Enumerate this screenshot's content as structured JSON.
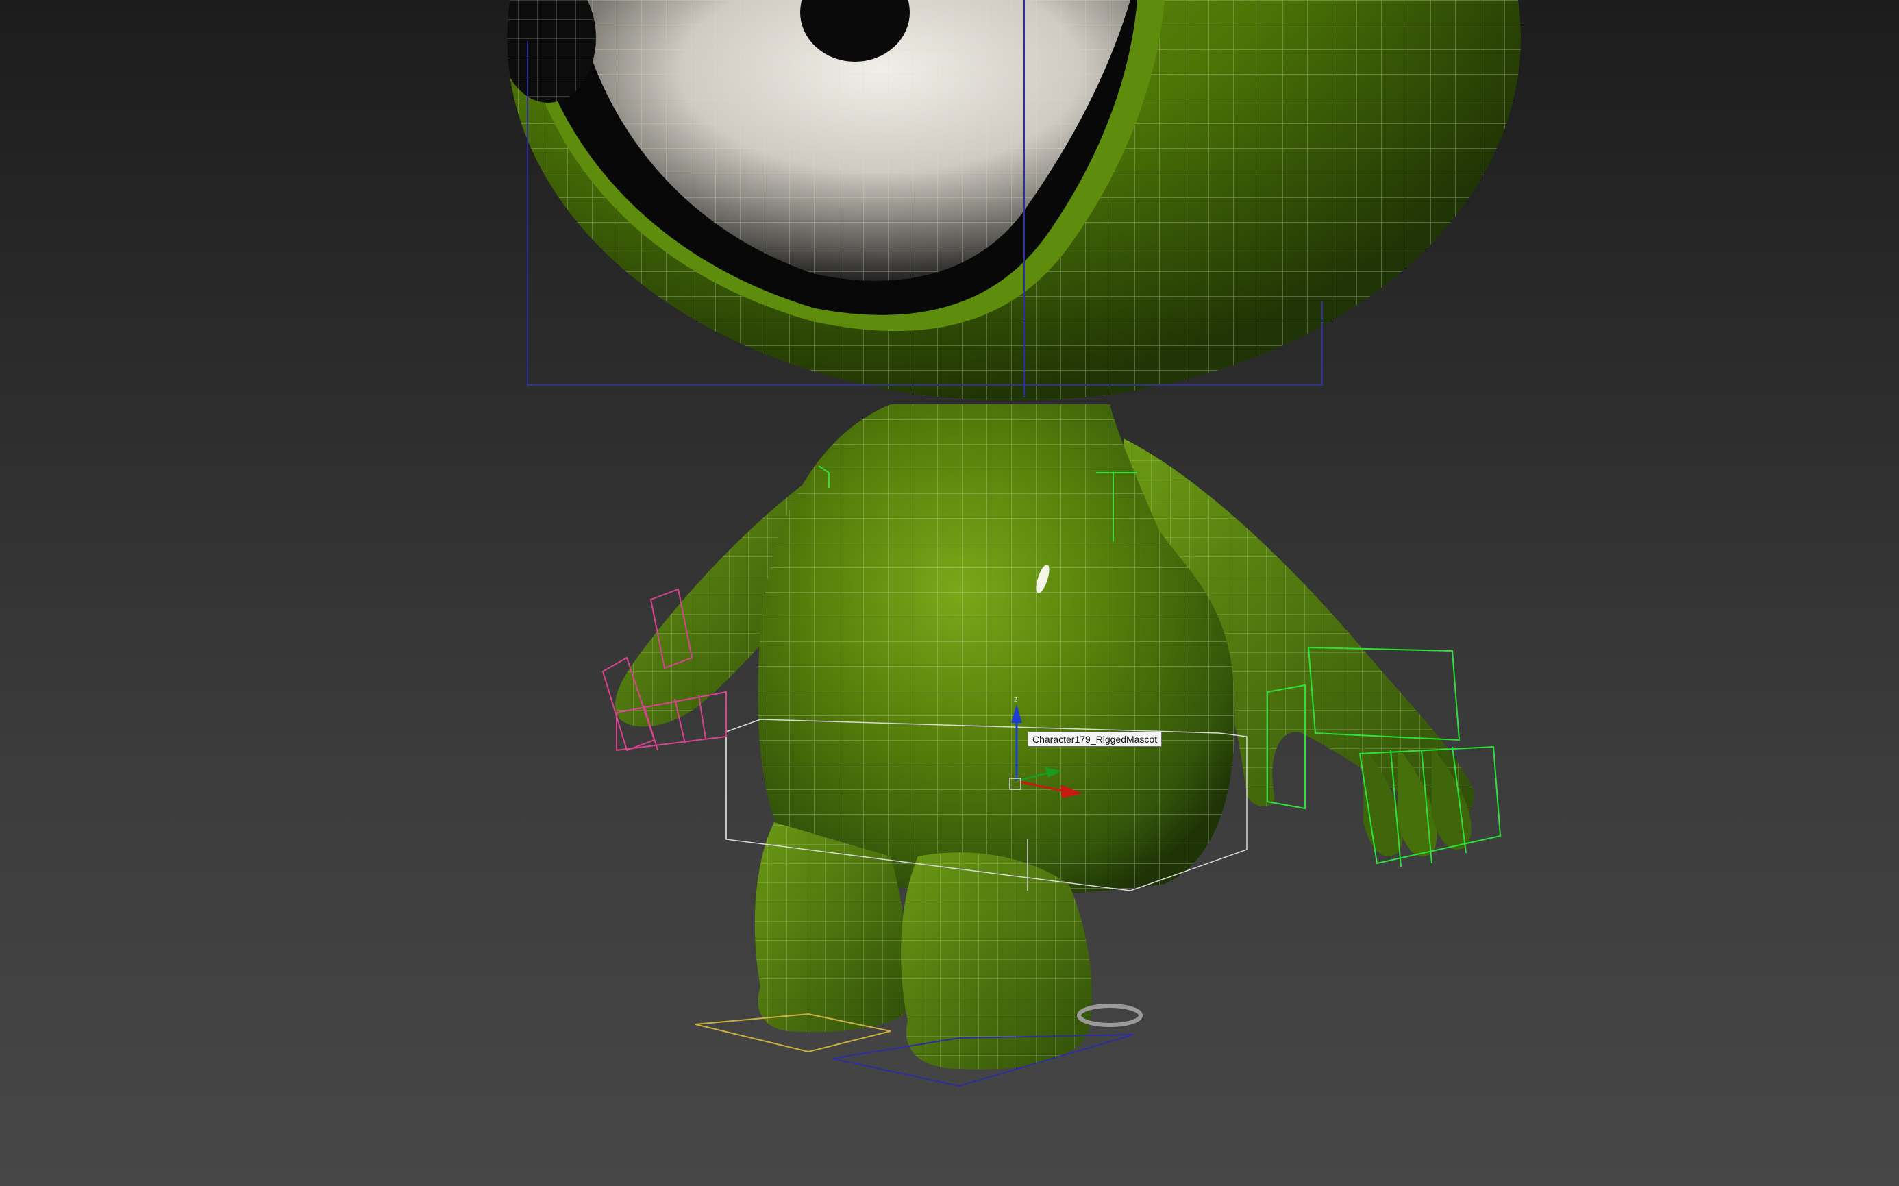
{
  "viewport": {
    "selected_object_label": "Character179_RiggedMascot"
  },
  "colors": {
    "body_green": "#4f7a08",
    "eye_white": "#e7e3dd",
    "wire": "#cfd8c0",
    "bbox_blue": "#2e2e9e",
    "hand_rig_left": "#d8428f",
    "hand_rig_right": "#2ee03a",
    "gizmo_z": "#1f3fd0",
    "gizmo_x": "#c81a12",
    "gizmo_y": "#1a9a20"
  }
}
